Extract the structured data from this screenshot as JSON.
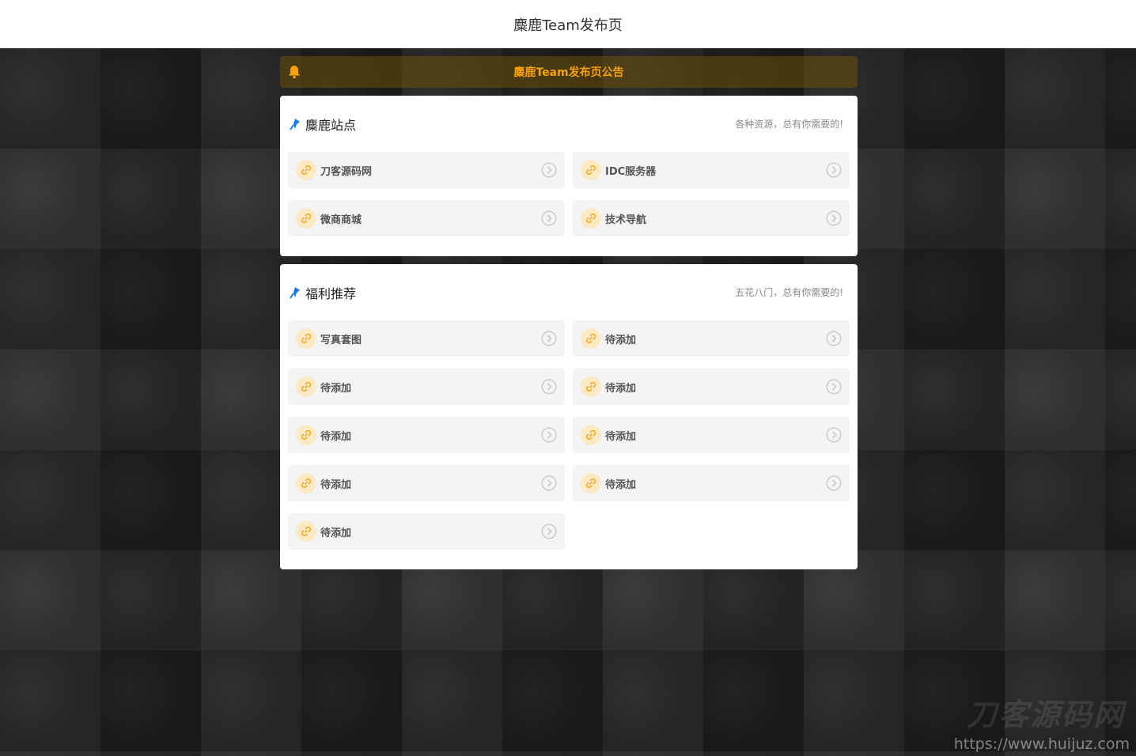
{
  "header": {
    "title": "麋鹿Team发布页"
  },
  "notice": {
    "text": "麋鹿Team发布页公告",
    "icon": "bell-icon",
    "color": "#f5a20a"
  },
  "sections": [
    {
      "title": "麋鹿站点",
      "subtitle": "各种资源，总有你需要的!",
      "icon": "pin-icon",
      "items": [
        "刀客源码网",
        "IDC服务器",
        "微商商城",
        "技术导航"
      ]
    },
    {
      "title": "福利推荐",
      "subtitle": "五花八门，总有你需要的!",
      "icon": "pin-icon",
      "items": [
        "写真套图",
        "待添加",
        "待添加",
        "待添加",
        "待添加",
        "待添加",
        "待添加",
        "待添加",
        "待添加"
      ]
    }
  ],
  "watermark": {
    "brand": "刀客源码网",
    "url": "https://www.huijuz.com"
  },
  "colors": {
    "accent": "#f5a20a",
    "pin": "#1677ff",
    "item_bg": "#f3f4f6"
  }
}
